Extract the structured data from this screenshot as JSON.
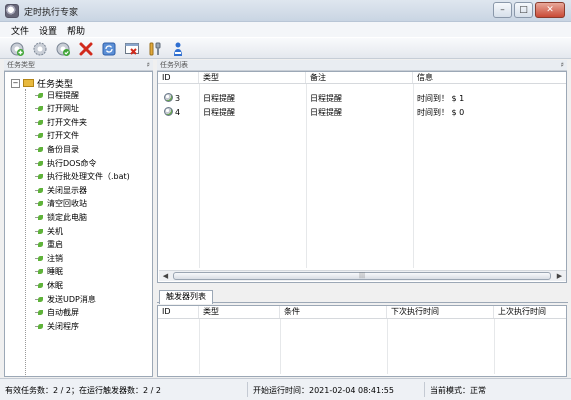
{
  "window": {
    "title": "定时执行专家",
    "minimize": "–",
    "maximize": "□",
    "close": "✕"
  },
  "menu": [
    {
      "label": "文件"
    },
    {
      "label": "设置"
    },
    {
      "label": "帮助"
    }
  ],
  "toolbar": {
    "buttons": [
      {
        "name": "add-task",
        "icon": "gear-plus-icon"
      },
      {
        "name": "edit-task",
        "icon": "gear-icon"
      },
      {
        "name": "enable-task",
        "icon": "gear-check-icon"
      },
      {
        "name": "delete-task",
        "icon": "delete-x-icon"
      },
      {
        "name": "refresh",
        "icon": "refresh-icon"
      },
      {
        "name": "close-window",
        "icon": "window-close-icon"
      },
      {
        "name": "tools",
        "icon": "tools-icon"
      },
      {
        "name": "about",
        "icon": "info-person-icon"
      }
    ]
  },
  "left_panel": {
    "header": "任务类型",
    "pin": "♯",
    "root": "任务类型",
    "items": [
      "日程提醒",
      "打开网址",
      "打开文件夹",
      "打开文件",
      "备份目录",
      "执行DOS命令",
      "执行批处理文件（.bat)",
      "关闭显示器",
      "清空回收站",
      "锁定此电脑",
      "关机",
      "重启",
      "注销",
      "睡眠",
      "休眠",
      "发送UDP消息",
      "自动截屏",
      "关闭程序"
    ]
  },
  "task_list": {
    "header": "任务列表",
    "pin": "♯",
    "columns": [
      "ID",
      "类型",
      "备注",
      "信息"
    ],
    "rows": [
      {
        "id": "3",
        "type": "日程提醒",
        "note": "日程提醒",
        "info": "时间到！ $ 1"
      },
      {
        "id": "4",
        "type": "日程提醒",
        "note": "日程提醒",
        "info": "时间到！ $ 0"
      }
    ],
    "scroll_grip": "|||"
  },
  "trigger_list": {
    "tab": "触发器列表",
    "columns": [
      "ID",
      "类型",
      "条件",
      "下次执行时间",
      "上次执行时间"
    ]
  },
  "status": {
    "tasks": "有效任务数：2 / 2；在运行触发器数：2 / 2",
    "start": "开始运行时间：2021-02-04 08:41:55",
    "mode": "当前模式：正常"
  }
}
